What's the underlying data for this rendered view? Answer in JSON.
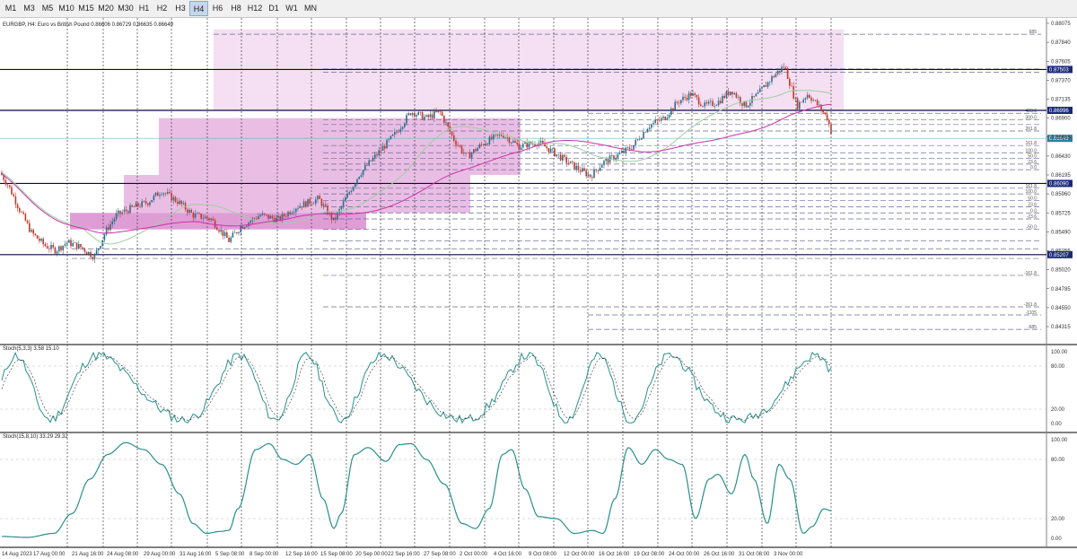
{
  "toolbar": {
    "timeframes": [
      "M1",
      "M3",
      "M5",
      "M10",
      "M15",
      "M20",
      "M30",
      "H1",
      "H2",
      "H3",
      "H4",
      "H6",
      "H8",
      "H12",
      "D1",
      "W1",
      "MN"
    ],
    "active": "H4"
  },
  "main_chart": {
    "title": "EURGBP, H4:  Euro vs British Pound  0.86606 0.86729 0.86635 0.86649",
    "price_axis": [
      "0.88075",
      "0.87840",
      "0.87605",
      "0.87370",
      "0.87135",
      "0.86900",
      "0.86665",
      "0.86430",
      "0.86195",
      "0.85960",
      "0.85725",
      "0.85490",
      "0.85255",
      "0.85020",
      "0.84785",
      "0.84550",
      "0.84315"
    ],
    "horizontal_lines": [
      "0.87503",
      "0.86996",
      "0.86090",
      "0.85207"
    ],
    "current_price": "0.86649",
    "fib_labels": [
      "685",
      "423.6",
      "300.0",
      "261.8",
      "161.8",
      "100.0",
      "50.0",
      "23.6",
      "0.0",
      "161.8",
      "100.0",
      "50.0",
      "23.6",
      "0.0",
      "-23.6",
      "-50.0",
      "-161.8",
      "-261.8",
      "-1105",
      "-685"
    ],
    "colors": {
      "up": "#2a6f8a",
      "down": "#c0392b",
      "ma_fast": "#9ccfa0",
      "ma_slow": "#cc33aa",
      "box_light": "#f3d9f0",
      "box_mid": "#e6b3df",
      "box_dark": "#d98ccf",
      "line_dark": "#0a0a3a",
      "tag_bg": "#1a2a7a",
      "price_tag": "#2a7fa0"
    }
  },
  "indicator1": {
    "title": "Stoch(5,3,3) 3.58 15.10",
    "levels": [
      "100.00",
      "80.00",
      "20.00",
      "0.00"
    ]
  },
  "indicator2": {
    "title": "Stoch(15,8,10) 33.29 29.32",
    "levels": [
      "100.00",
      "80.00",
      "20.00",
      "0.00"
    ]
  },
  "time_axis": [
    "14 Aug 2023",
    "17 Aug 00:00",
    "21 Aug 16:00",
    "24 Aug 08:00",
    "29 Aug 00:00",
    "31 Aug 16:00",
    "5 Sep 08:00",
    "8 Sep 00:00",
    "12 Sep 16:00",
    "15 Sep 08:00",
    "20 Sep 00:00",
    "22 Sep 16:00",
    "27 Sep 08:00",
    "2 Oct 00:00",
    "4 Oct 16:00",
    "9 Oct 08:00",
    "12 Oct 00:00",
    "16 Oct 16:00",
    "19 Oct 08:00",
    "24 Oct 00:00",
    "26 Oct 16:00",
    "31 Oct 08:00",
    "3 Nov 00:00"
  ]
}
